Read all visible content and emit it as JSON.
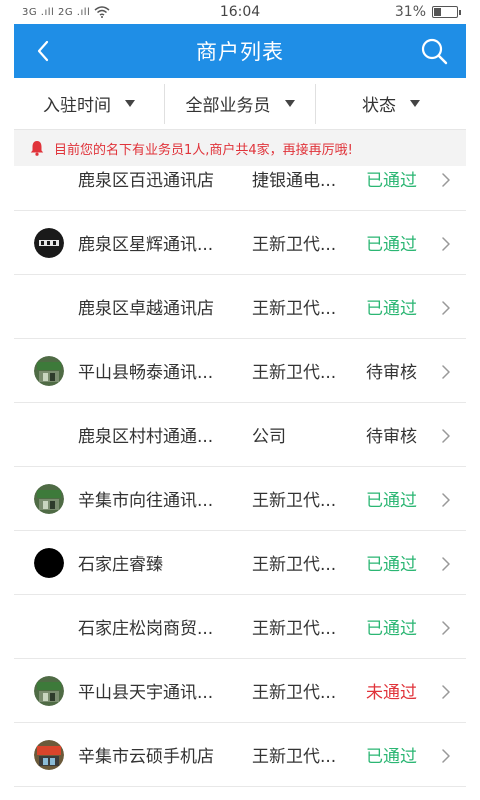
{
  "status_bar": {
    "signal_text": "3G .ıll 2G .ıll",
    "time": "16:04",
    "battery": "31%",
    "battery_level": 0.31
  },
  "header": {
    "title": "商户列表",
    "back_icon": "chevron-left-icon",
    "search_icon": "search-icon"
  },
  "filters": [
    {
      "label": "入驻时间"
    },
    {
      "label": "全部业务员"
    },
    {
      "label": "状态"
    }
  ],
  "notice": {
    "icon": "bell-icon",
    "text": "目前您的名下有业务员1人,商户共4家，再接再厉哦!"
  },
  "colors": {
    "brand": "#1f8ee6",
    "approved": "#2bb673",
    "pending": "#333333",
    "rejected": "#e0333a",
    "notice_text": "#e0333a"
  },
  "merchants": [
    {
      "name": "鹿泉区百迅通讯店",
      "salesman": "捷银通电...",
      "status": "已通过",
      "status_type": "approved",
      "avatar": "none"
    },
    {
      "name": "鹿泉区星辉通讯...",
      "salesman": "王新卫代...",
      "status": "已通过",
      "status_type": "approved",
      "avatar": "photo-dark-logo"
    },
    {
      "name": "鹿泉区卓越通讯店",
      "salesman": "王新卫代...",
      "status": "已通过",
      "status_type": "approved",
      "avatar": "none"
    },
    {
      "name": "平山县畅泰通讯...",
      "salesman": "王新卫代...",
      "status": "待审核",
      "status_type": "pending",
      "avatar": "photo-storefront"
    },
    {
      "name": "鹿泉区村村通通...",
      "salesman": "公司",
      "status": "待审核",
      "status_type": "pending",
      "avatar": "none"
    },
    {
      "name": "辛集市向往通讯...",
      "salesman": "王新卫代...",
      "status": "已通过",
      "status_type": "approved",
      "avatar": "photo-storefront"
    },
    {
      "name": "石家庄睿臻",
      "salesman": "王新卫代...",
      "status": "已通过",
      "status_type": "approved",
      "avatar": "black-circle"
    },
    {
      "name": "石家庄松岗商贸...",
      "salesman": "王新卫代...",
      "status": "已通过",
      "status_type": "approved",
      "avatar": "none"
    },
    {
      "name": "平山县天宇通讯...",
      "salesman": "王新卫代...",
      "status": "未通过",
      "status_type": "rejected",
      "avatar": "photo-storefront"
    },
    {
      "name": "辛集市云硕手机店",
      "salesman": "王新卫代...",
      "status": "已通过",
      "status_type": "approved",
      "avatar": "photo-storefront-red"
    }
  ]
}
